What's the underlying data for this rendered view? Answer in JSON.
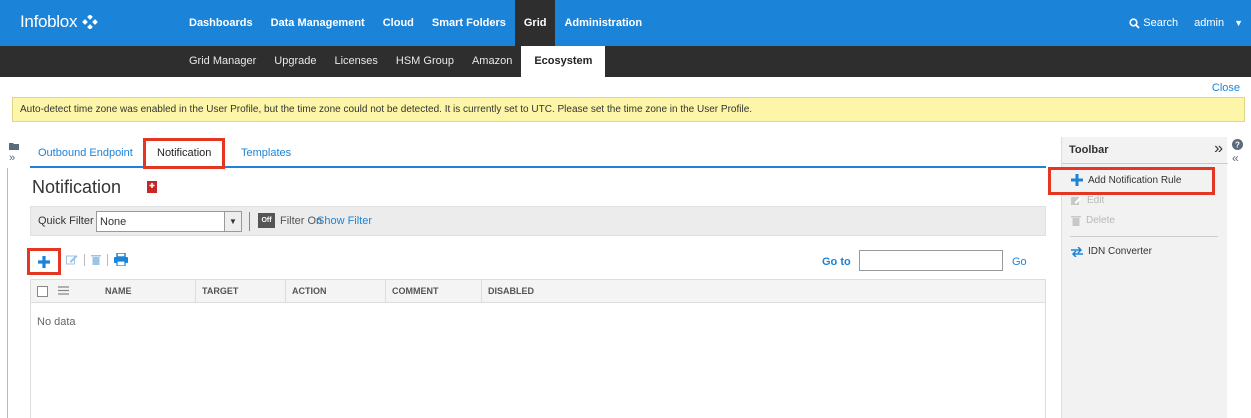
{
  "header": {
    "logo_text": "Infoblox",
    "nav": [
      {
        "label": "Dashboards",
        "active": false
      },
      {
        "label": "Data Management",
        "active": false
      },
      {
        "label": "Cloud",
        "active": false
      },
      {
        "label": "Smart Folders",
        "active": false
      },
      {
        "label": "Grid",
        "active": true
      },
      {
        "label": "Administration",
        "active": false
      }
    ],
    "search_label": "Search",
    "user_label": "admin"
  },
  "subnav": [
    {
      "label": "Grid Manager",
      "active": false
    },
    {
      "label": "Upgrade",
      "active": false
    },
    {
      "label": "Licenses",
      "active": false
    },
    {
      "label": "HSM Group",
      "active": false
    },
    {
      "label": "Amazon",
      "active": false
    },
    {
      "label": "Ecosystem",
      "active": true
    }
  ],
  "close_label": "Close",
  "banner_text": "Auto-detect time zone was enabled in the User Profile, but the time zone could not be detected. It is currently set to UTC. Please set the time zone in the User Profile.",
  "tabs": [
    {
      "label": "Outbound Endpoint",
      "active": false
    },
    {
      "label": "Notification",
      "active": true
    },
    {
      "label": "Templates",
      "active": false
    }
  ],
  "page_title": "Notification",
  "filter": {
    "quick_filter_label": "Quick Filter",
    "quick_filter_value": "None",
    "toggle_label": "Off",
    "filter_on_label": "Filter On",
    "show_filter_label": "Show Filter"
  },
  "goto": {
    "label": "Go to",
    "value": "",
    "go_label": "Go"
  },
  "grid": {
    "columns": [
      "NAME",
      "TARGET",
      "ACTION",
      "COMMENT",
      "DISABLED"
    ],
    "empty_text": "No data"
  },
  "toolbar": {
    "title": "Toolbar",
    "actions": [
      {
        "label": "Add Notification Rule",
        "enabled": true
      },
      {
        "label": "Edit",
        "enabled": false
      },
      {
        "label": "Delete",
        "enabled": false
      },
      {
        "label": "IDN Converter",
        "enabled": true
      }
    ]
  },
  "colors": {
    "brand_blue": "#1b84d8",
    "dark_bar": "#2e2e2e",
    "highlight_red": "#e53623",
    "banner_yellow": "#fdf6a8"
  }
}
